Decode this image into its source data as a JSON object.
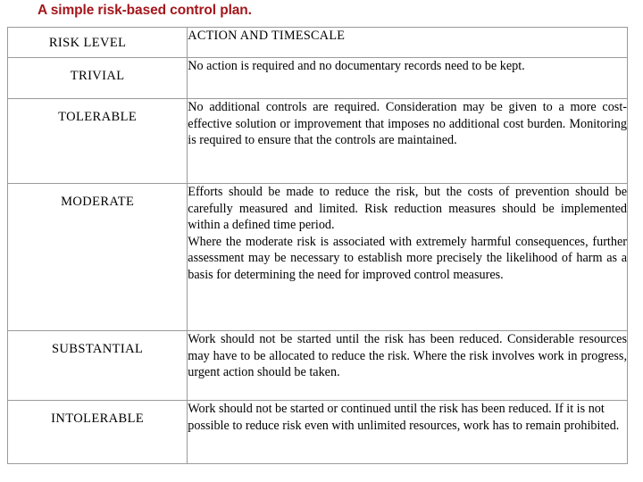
{
  "title": "A simple risk-based control plan.",
  "colors": {
    "title": "#a3161b",
    "border": "#9a9a9a",
    "text": "#000000",
    "background": "#ffffff"
  },
  "table": {
    "headers": {
      "level": "RISK LEVEL",
      "action": "ACTION AND TIMESCALE"
    },
    "rows": [
      {
        "level": "TRIVIAL",
        "paragraphs": [
          "No action is required and no documentary records need to be kept."
        ]
      },
      {
        "level": "TOLERABLE",
        "paragraphs": [
          "No additional controls are required.  Consideration may be given to a more cost-effective solution or improvement that imposes no additional cost burden. Monitoring is required to ensure that the controls are maintained."
        ]
      },
      {
        "level": "MODERATE",
        "paragraphs": [
          "Efforts should be made to reduce the risk, but the costs of prevention should be carefully measured and limited.  Risk reduction measures should be implemented within a defined time period.",
          "Where the moderate risk is associated with extremely harmful consequences, further assessment may be necessary to establish more precisely the likelihood of harm as a basis for determining the need for improved control measures."
        ]
      },
      {
        "level": "SUBSTANTIAL",
        "paragraphs": [
          "Work should not be started until the risk has been reduced. Considerable resources may have to be allocated to reduce the risk. Where the risk involves work in progress, urgent action should be taken."
        ]
      },
      {
        "level": "INTOLERABLE",
        "paragraphs": [
          "Work should not be started or continued until the risk has been reduced. If it is not possible to reduce risk even with unlimited  resources, work has to remain prohibited."
        ]
      }
    ]
  }
}
